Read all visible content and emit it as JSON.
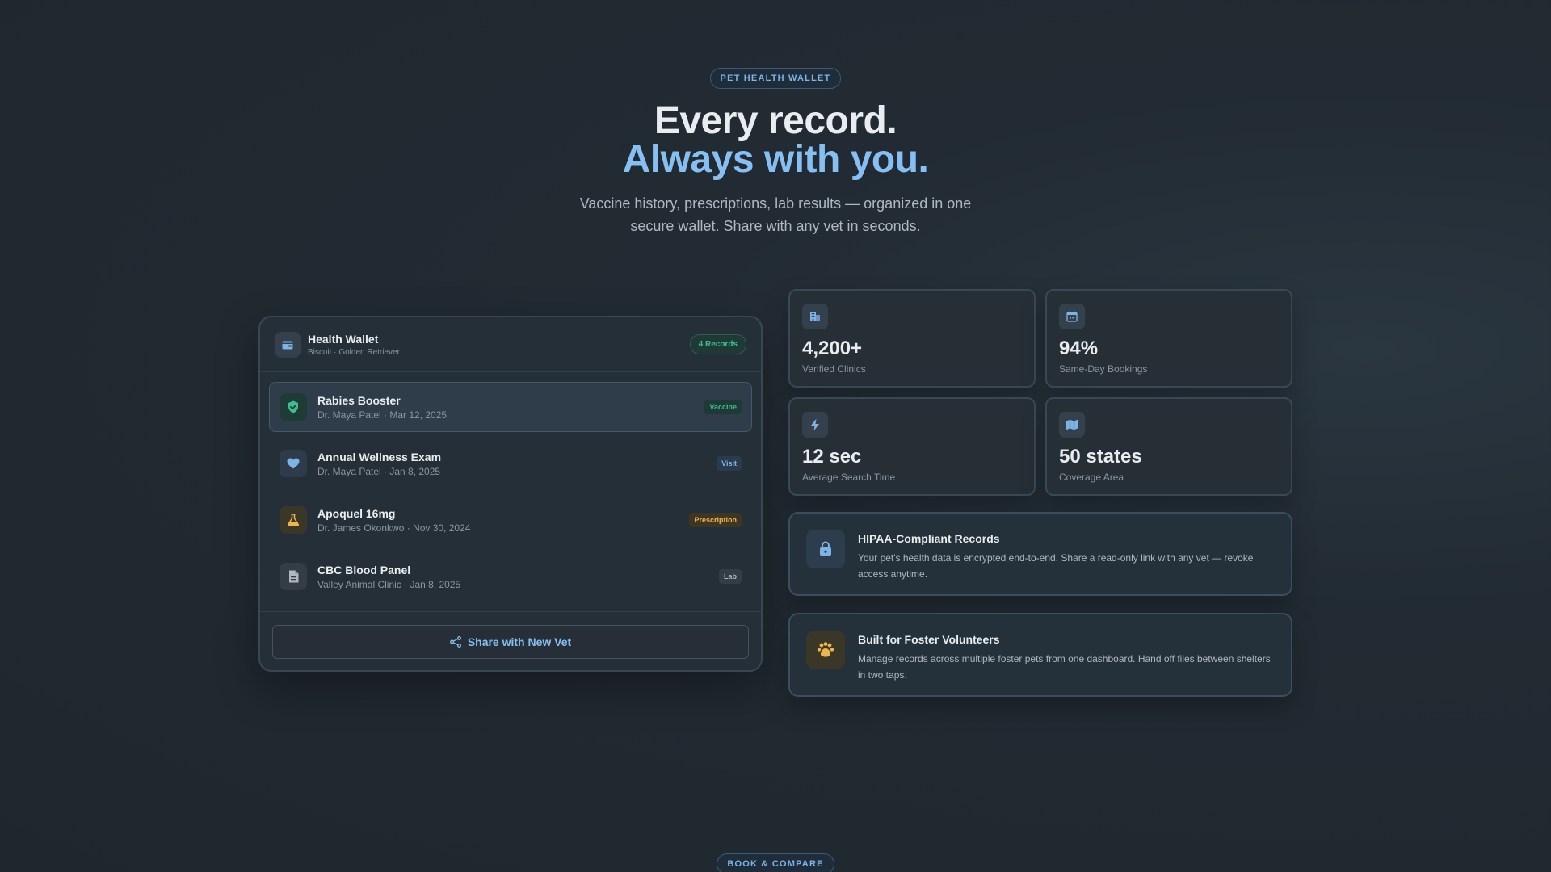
{
  "hero": {
    "eyebrow": "PET HEALTH WALLET",
    "title_line1": "Every record.",
    "title_line2": "Always with you.",
    "subtitle": "Vaccine history, prescriptions, lab results — organized in one secure wallet. Share with any vet in seconds."
  },
  "wallet": {
    "title": "Health Wallet",
    "subtitle": "Biscuit · Golden Retriever",
    "badge": "4 Records",
    "icon": "wallet-icon",
    "records": [
      {
        "title": "Rabies Booster",
        "meta": "Dr. Maya Patel · Mar 12, 2025",
        "tag": "Vaccine",
        "icon": "shield-check-icon",
        "color": "#3dbd90"
      },
      {
        "title": "Annual Wellness Exam",
        "meta": "Dr. Maya Patel · Jan 8, 2025",
        "tag": "Visit",
        "icon": "heart-icon",
        "color": "#7db4e6"
      },
      {
        "title": "Apoquel 16mg",
        "meta": "Dr. James Okonkwo · Nov 30, 2024",
        "tag": "Prescription",
        "icon": "flask-icon",
        "color": "#f0b54a"
      },
      {
        "title": "CBC Blood Panel",
        "meta": "Valley Animal Clinic · Jan 8, 2025",
        "tag": "Lab",
        "icon": "document-icon",
        "color": "#aeb8c2"
      }
    ],
    "share_label": "Share with New Vet"
  },
  "stats": [
    {
      "value": "4,200+",
      "label": "Verified Clinics",
      "icon": "building-icon"
    },
    {
      "value": "94%",
      "label": "Same-Day Bookings",
      "icon": "calendar-icon"
    },
    {
      "value": "12 sec",
      "label": "Average Search Time",
      "icon": "lightning-icon"
    },
    {
      "value": "50 states",
      "label": "Coverage Area",
      "icon": "map-icon"
    }
  ],
  "features": [
    {
      "title": "HIPAA-Compliant Records",
      "desc": "Your pet's health data is encrypted end-to-end. Share a read-only link with any vet — revoke access anytime.",
      "icon": "lock-icon"
    },
    {
      "title": "Built for Foster Volunteers",
      "desc": "Manage records across multiple foster pets from one dashboard. Hand off files between shelters in two taps.",
      "icon": "paw-icon"
    }
  ],
  "footer": {
    "eyebrow": "BOOK & COMPARE"
  },
  "colors": {
    "accent": "#86bff2",
    "vaccine": "#3dbd90",
    "prescription": "#f0b54a"
  }
}
